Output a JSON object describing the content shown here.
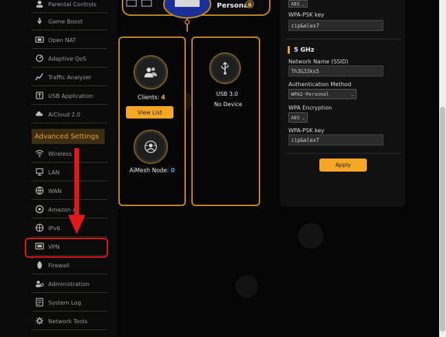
{
  "sidebar": {
    "items_top": [
      {
        "label": "Parental Controls",
        "icon": "parental-icon"
      },
      {
        "label": "Game Boost",
        "icon": "rocket-icon"
      },
      {
        "label": "Open NAT",
        "icon": "nat-icon"
      },
      {
        "label": "Adaptive QoS",
        "icon": "qos-icon"
      },
      {
        "label": "Traffic Analyzer",
        "icon": "analyzer-icon"
      },
      {
        "label": "USB Application",
        "icon": "usb-icon"
      },
      {
        "label": "AiCloud 2.0",
        "icon": "cloud-icon"
      }
    ],
    "advanced_header": "Advanced Settings",
    "items_advanced": [
      {
        "label": "Wireless",
        "icon": "wireless-icon"
      },
      {
        "label": "LAN",
        "icon": "lan-icon"
      },
      {
        "label": "WAN",
        "icon": "wan-icon"
      },
      {
        "label": "Amazon Al",
        "icon": "amazon-icon"
      },
      {
        "label": "IPv6",
        "icon": "ipv6-icon"
      },
      {
        "label": "VPN",
        "icon": "vpn-icon"
      },
      {
        "label": "Firewall",
        "icon": "firewall-icon"
      },
      {
        "label": "Administration",
        "icon": "admin-icon"
      },
      {
        "label": "System Log",
        "icon": "log-icon"
      },
      {
        "label": "Network Tools",
        "icon": "tools-icon"
      }
    ]
  },
  "network_map": {
    "security_label": "Personal",
    "clients_label": "Clients:",
    "clients_count": "4",
    "view_list_label": "View List",
    "aimesh_label": "AiMesh Node:",
    "aimesh_count": "0",
    "usb_label": "USB 3.0",
    "usb_status": "No Device"
  },
  "settings": {
    "band24": {
      "encryption_value": "AES",
      "psk_label": "WPA-PSK key",
      "psk_value": "cip&alex7"
    },
    "band5": {
      "title": "5 GHz",
      "ssid_label": "Network Name (SSID)",
      "ssid_value": "Th3G33ks5",
      "auth_label": "Authentication Method",
      "auth_value": "WPA2-Personal",
      "enc_label": "WPA Encryption",
      "enc_value": "AES",
      "psk_label": "WPA-PSK key",
      "psk_value": "cip&alex7"
    },
    "apply_label": "Apply"
  },
  "colors": {
    "accent": "#f5a623",
    "border_gold": "#c78a1b",
    "highlight_red": "#e0181a"
  }
}
